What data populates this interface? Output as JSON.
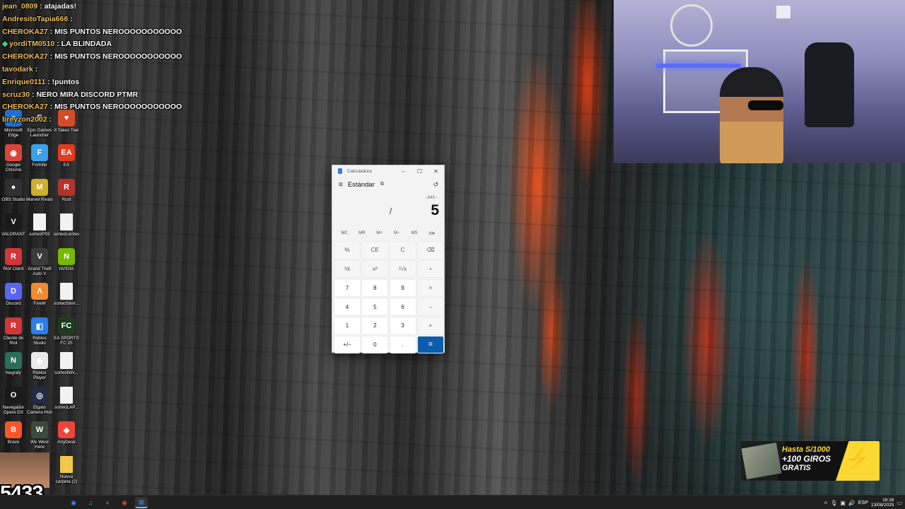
{
  "chat": [
    {
      "user": "jean_0809",
      "msg": "atajadas!"
    },
    {
      "user": "AndresitoTapia666",
      "msg": ""
    },
    {
      "user": "CHEROKA27",
      "msg": "MIS PUNTOS NEROOOOOOOOOOO"
    },
    {
      "user": "yordiTM0510",
      "msg": "LA BLINDADA",
      "diamond": "◆"
    },
    {
      "user": "CHEROKA27",
      "msg": "MIS PUNTOS NEROOOOOOOOOOO"
    },
    {
      "user": "tavodark",
      "msg": ""
    },
    {
      "user": "Enrique0111",
      "msg": "!puntos"
    },
    {
      "user": "scruz30",
      "msg": "NERO MIRA DISCORD PTMR"
    },
    {
      "user": "CHEROKA27",
      "msg": "MIS PUNTOS NEROOOOOOOOOOO"
    },
    {
      "user": "breyzon2002",
      "msg": ""
    }
  ],
  "chat_sep": " : ",
  "desktop_icons": [
    {
      "label": "Microsoft Edge",
      "color": "#1d6fd1",
      "glyph": "e"
    },
    {
      "label": "Epic Games Launcher",
      "color": "#2a2a2a",
      "glyph": "E"
    },
    {
      "label": "It Takes Two",
      "color": "#d44a2a",
      "glyph": "♥"
    },
    {
      "label": "Google Chrome",
      "color": "#db4437",
      "glyph": "◉"
    },
    {
      "label": "Fortnite",
      "color": "#3aa0e8",
      "glyph": "F"
    },
    {
      "label": "EA",
      "color": "#e23b1f",
      "glyph": "EA"
    },
    {
      "label": "OBS Studio",
      "color": "#303030",
      "glyph": "●"
    },
    {
      "label": "Marvel Rivals",
      "color": "#cfae2a",
      "glyph": "M"
    },
    {
      "label": "Rust",
      "color": "#b5322a",
      "glyph": "R"
    },
    {
      "label": "VALORANT",
      "color": "#1a1a1a",
      "glyph": "V"
    },
    {
      "label": "sorteoPS5",
      "color": "#f2f2f2",
      "glyph": ""
    },
    {
      "label": "sorteoLentes",
      "color": "#f2f2f2",
      "glyph": ""
    },
    {
      "label": "Riot Client",
      "color": "#d13639",
      "glyph": "R"
    },
    {
      "label": "Grand Theft Auto V",
      "color": "#3b3b3b",
      "glyph": "V"
    },
    {
      "label": "NVIDIA",
      "color": "#76b900",
      "glyph": "N"
    },
    {
      "label": "Discord",
      "color": "#5865f2",
      "glyph": "D"
    },
    {
      "label": "FiveM",
      "color": "#f28a30",
      "glyph": "Λ"
    },
    {
      "label": "sorteoSem...",
      "color": "#f2f2f2",
      "glyph": ""
    },
    {
      "label": "Cliente de Riot",
      "color": "#d13639",
      "glyph": "R"
    },
    {
      "label": "Roblox Studio",
      "color": "#2b7de9",
      "glyph": "◧"
    },
    {
      "label": "EA SPORTS FC 25",
      "color": "#1f3b1f",
      "glyph": "FC"
    },
    {
      "label": "Negraly",
      "color": "#2a6e5a",
      "glyph": "N"
    },
    {
      "label": "Roblox Player",
      "color": "#eaeaea",
      "glyph": "◆"
    },
    {
      "label": "sorteoNIN...",
      "color": "#f2f2f2",
      "glyph": ""
    },
    {
      "label": "Navegador Opera GX",
      "color": "#1a1a1a",
      "glyph": "O"
    },
    {
      "label": "Elgato Camera Hub",
      "color": "#222a44",
      "glyph": "◎"
    },
    {
      "label": "sorteoLAP...",
      "color": "#f2f2f2",
      "glyph": ""
    },
    {
      "label": "Brave",
      "color": "#fb542b",
      "glyph": "B"
    },
    {
      "label": "We Were Here",
      "color": "#3c4a3c",
      "glyph": "W"
    },
    {
      "label": "AnyDesk",
      "color": "#ef443b",
      "glyph": "◆"
    },
    {
      "label": "Nueva carpeta (2)",
      "color": "#f2c94c",
      "glyph": ""
    }
  ],
  "calculator": {
    "window_title": "Calculadora",
    "mode": "Estándar",
    "expression": "-343 -",
    "result": "5",
    "memory_buttons": [
      "MC",
      "MR",
      "M+",
      "M−",
      "MS",
      "M▾"
    ],
    "keys": [
      {
        "label": "%",
        "kind": "op"
      },
      {
        "label": "CE",
        "kind": "op"
      },
      {
        "label": "C",
        "kind": "op"
      },
      {
        "label": "⌫",
        "kind": "op"
      },
      {
        "label": "⅟x",
        "kind": "op"
      },
      {
        "label": "x²",
        "kind": "op"
      },
      {
        "label": "²√x",
        "kind": "op"
      },
      {
        "label": "÷",
        "kind": "op"
      },
      {
        "label": "7",
        "kind": "num"
      },
      {
        "label": "8",
        "kind": "num"
      },
      {
        "label": "9",
        "kind": "num"
      },
      {
        "label": "×",
        "kind": "op"
      },
      {
        "label": "4",
        "kind": "num"
      },
      {
        "label": "5",
        "kind": "num"
      },
      {
        "label": "6",
        "kind": "num"
      },
      {
        "label": "−",
        "kind": "op"
      },
      {
        "label": "1",
        "kind": "num"
      },
      {
        "label": "2",
        "kind": "num"
      },
      {
        "label": "3",
        "kind": "num"
      },
      {
        "label": "+",
        "kind": "op"
      },
      {
        "label": "+/−",
        "kind": "num"
      },
      {
        "label": "0",
        "kind": "num"
      },
      {
        "label": ".",
        "kind": "num"
      },
      {
        "label": "=",
        "kind": "eq"
      }
    ],
    "accent_color": "#0b5cad"
  },
  "ad": {
    "line1": "Hasta S/1000",
    "line2": "+100 GIROS",
    "line3": "GRATIS"
  },
  "counter": "5433",
  "taskbar": {
    "apps": [
      {
        "name": "chrome",
        "glyph": "◉",
        "color": "#4285f4"
      },
      {
        "name": "spotify",
        "glyph": "♫",
        "color": "#1db954"
      },
      {
        "name": "obs",
        "glyph": "●",
        "color": "#555"
      },
      {
        "name": "chrome-2",
        "glyph": "◉",
        "color": "#db4437"
      },
      {
        "name": "calculator",
        "glyph": "▦",
        "color": "#3a7bd5",
        "active": true
      }
    ],
    "language": "ESP",
    "time": "16:16",
    "date": "13/08/2025"
  }
}
